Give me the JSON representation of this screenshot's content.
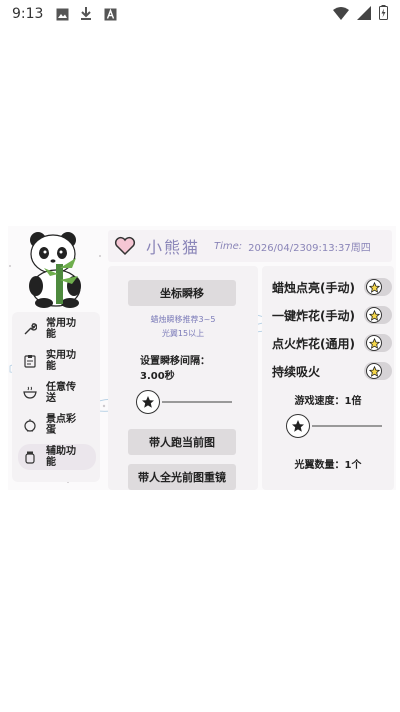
{
  "status_bar": {
    "time": "9:13",
    "icons_left": [
      "image-icon",
      "download-icon",
      "font-icon"
    ],
    "icons_right": [
      "wifi-icon",
      "signal-icon",
      "battery-icon"
    ]
  },
  "header": {
    "title": "小熊猫",
    "time_label": "Time:",
    "time_value": "2026/04/2309:13:37周四"
  },
  "sidebar": {
    "items": [
      {
        "label": "常用功能",
        "icon": "wrench-icon",
        "active": false
      },
      {
        "label": "实用功能",
        "icon": "clipboard-icon",
        "active": false
      },
      {
        "label": "任意传送",
        "icon": "bowl-icon",
        "active": false
      },
      {
        "label": "景点彩蛋",
        "icon": "lantern-icon",
        "active": false
      },
      {
        "label": "辅助功能",
        "icon": "jar-icon",
        "active": true
      }
    ]
  },
  "middle": {
    "coord_button": "坐标瞬移",
    "hint_line1": "蜡烛瞬移推荐3~5",
    "hint_line2": "光翼15以上",
    "interval_label": "设置瞬移间隔：",
    "interval_value": "3.00秒",
    "interval_slider_fraction": 0.0,
    "run_button": "带人跑当前图",
    "partial_button": "带人全光前图重镜"
  },
  "right": {
    "toggles": [
      {
        "label": "蜡烛点亮(手动)",
        "on": false
      },
      {
        "label": "一键炸花(手动)",
        "on": false
      },
      {
        "label": "点火炸花(通用)",
        "on": false
      },
      {
        "label": "持续吸火",
        "on": false
      }
    ],
    "speed_label": "游戏速度：1倍",
    "speed_slider_fraction": 0.0,
    "wings_label": "光翼数量：1个"
  },
  "colors": {
    "accent": "#8a85b8",
    "heart_fill": "#f5c6d4",
    "star_fill": "#f7d84a",
    "panel_bg": "#f4f2f4"
  }
}
